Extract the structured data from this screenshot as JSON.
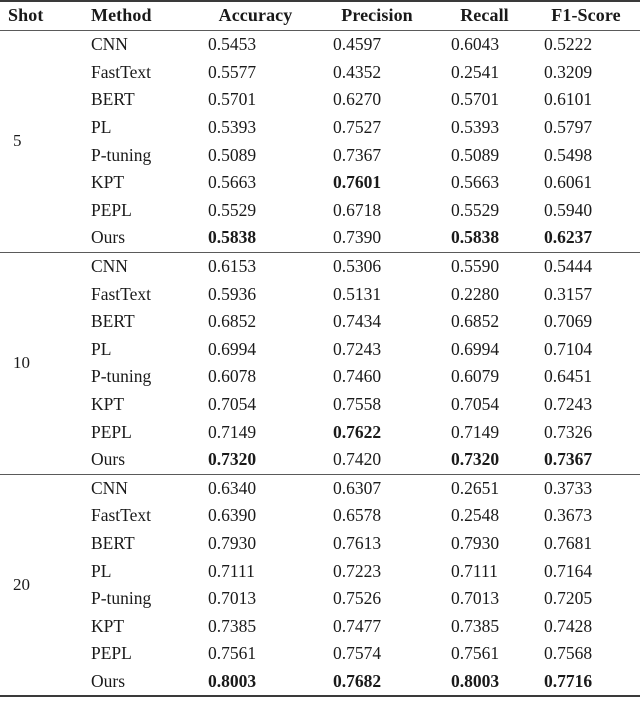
{
  "table": {
    "caption_visible": false,
    "columns": [
      "Shot",
      "Method",
      "Accuracy",
      "Precision",
      "Recall",
      "F1-Score"
    ],
    "header": {
      "shot": "Shot",
      "method": "Method",
      "accuracy": "Accuracy",
      "precision": "Precision",
      "recall": "Recall",
      "f1": "F1-Score"
    },
    "blocks": [
      {
        "shot": "5",
        "rows": [
          {
            "method": "CNN",
            "accuracy": "0.5453",
            "precision": "0.4597",
            "recall": "0.6043",
            "f1": "0.5222",
            "bold": {
              "accuracy": false,
              "precision": false,
              "recall": false,
              "f1": false
            }
          },
          {
            "method": "FastText",
            "accuracy": "0.5577",
            "precision": "0.4352",
            "recall": "0.2541",
            "f1": "0.3209",
            "bold": {
              "accuracy": false,
              "precision": false,
              "recall": false,
              "f1": false
            }
          },
          {
            "method": "BERT",
            "accuracy": "0.5701",
            "precision": "0.6270",
            "recall": "0.5701",
            "f1": "0.6101",
            "bold": {
              "accuracy": false,
              "precision": false,
              "recall": false,
              "f1": false
            }
          },
          {
            "method": "PL",
            "accuracy": "0.5393",
            "precision": "0.7527",
            "recall": "0.5393",
            "f1": "0.5797",
            "bold": {
              "accuracy": false,
              "precision": false,
              "recall": false,
              "f1": false
            }
          },
          {
            "method": "P-tuning",
            "accuracy": "0.5089",
            "precision": "0.7367",
            "recall": "0.5089",
            "f1": "0.5498",
            "bold": {
              "accuracy": false,
              "precision": false,
              "recall": false,
              "f1": false
            }
          },
          {
            "method": "KPT",
            "accuracy": "0.5663",
            "precision": "0.7601",
            "recall": "0.5663",
            "f1": "0.6061",
            "bold": {
              "accuracy": false,
              "precision": true,
              "recall": false,
              "f1": false
            }
          },
          {
            "method": "PEPL",
            "accuracy": "0.5529",
            "precision": "0.6718",
            "recall": "0.5529",
            "f1": "0.5940",
            "bold": {
              "accuracy": false,
              "precision": false,
              "recall": false,
              "f1": false
            }
          },
          {
            "method": "Ours",
            "accuracy": "0.5838",
            "precision": "0.7390",
            "recall": "0.5838",
            "f1": "0.6237",
            "bold": {
              "accuracy": true,
              "precision": false,
              "recall": true,
              "f1": true
            }
          }
        ]
      },
      {
        "shot": "10",
        "rows": [
          {
            "method": "CNN",
            "accuracy": "0.6153",
            "precision": "0.5306",
            "recall": "0.5590",
            "f1": "0.5444",
            "bold": {
              "accuracy": false,
              "precision": false,
              "recall": false,
              "f1": false
            }
          },
          {
            "method": "FastText",
            "accuracy": "0.5936",
            "precision": "0.5131",
            "recall": "0.2280",
            "f1": "0.3157",
            "bold": {
              "accuracy": false,
              "precision": false,
              "recall": false,
              "f1": false
            }
          },
          {
            "method": "BERT",
            "accuracy": "0.6852",
            "precision": "0.7434",
            "recall": "0.6852",
            "f1": "0.7069",
            "bold": {
              "accuracy": false,
              "precision": false,
              "recall": false,
              "f1": false
            }
          },
          {
            "method": "PL",
            "accuracy": "0.6994",
            "precision": "0.7243",
            "recall": "0.6994",
            "f1": "0.7104",
            "bold": {
              "accuracy": false,
              "precision": false,
              "recall": false,
              "f1": false
            }
          },
          {
            "method": "P-tuning",
            "accuracy": "0.6078",
            "precision": "0.7460",
            "recall": "0.6079",
            "f1": "0.6451",
            "bold": {
              "accuracy": false,
              "precision": false,
              "recall": false,
              "f1": false
            }
          },
          {
            "method": "KPT",
            "accuracy": "0.7054",
            "precision": "0.7558",
            "recall": "0.7054",
            "f1": "0.7243",
            "bold": {
              "accuracy": false,
              "precision": false,
              "recall": false,
              "f1": false
            }
          },
          {
            "method": "PEPL",
            "accuracy": "0.7149",
            "precision": "0.7622",
            "recall": "0.7149",
            "f1": "0.7326",
            "bold": {
              "accuracy": false,
              "precision": true,
              "recall": false,
              "f1": false
            }
          },
          {
            "method": "Ours",
            "accuracy": "0.7320",
            "precision": "0.7420",
            "recall": "0.7320",
            "f1": "0.7367",
            "bold": {
              "accuracy": true,
              "precision": false,
              "recall": true,
              "f1": true
            }
          }
        ]
      },
      {
        "shot": "20",
        "rows": [
          {
            "method": "CNN",
            "accuracy": "0.6340",
            "precision": "0.6307",
            "recall": "0.2651",
            "f1": "0.3733",
            "bold": {
              "accuracy": false,
              "precision": false,
              "recall": false,
              "f1": false
            }
          },
          {
            "method": "FastText",
            "accuracy": "0.6390",
            "precision": "0.6578",
            "recall": "0.2548",
            "f1": "0.3673",
            "bold": {
              "accuracy": false,
              "precision": false,
              "recall": false,
              "f1": false
            }
          },
          {
            "method": "BERT",
            "accuracy": "0.7930",
            "precision": "0.7613",
            "recall": "0.7930",
            "f1": "0.7681",
            "bold": {
              "accuracy": false,
              "precision": false,
              "recall": false,
              "f1": false
            }
          },
          {
            "method": "PL",
            "accuracy": "0.7111",
            "precision": "0.7223",
            "recall": "0.7111",
            "f1": "0.7164",
            "bold": {
              "accuracy": false,
              "precision": false,
              "recall": false,
              "f1": false
            }
          },
          {
            "method": "P-tuning",
            "accuracy": "0.7013",
            "precision": "0.7526",
            "recall": "0.7013",
            "f1": "0.7205",
            "bold": {
              "accuracy": false,
              "precision": false,
              "recall": false,
              "f1": false
            }
          },
          {
            "method": "KPT",
            "accuracy": "0.7385",
            "precision": "0.7477",
            "recall": "0.7385",
            "f1": "0.7428",
            "bold": {
              "accuracy": false,
              "precision": false,
              "recall": false,
              "f1": false
            }
          },
          {
            "method": "PEPL",
            "accuracy": "0.7561",
            "precision": "0.7574",
            "recall": "0.7561",
            "f1": "0.7568",
            "bold": {
              "accuracy": false,
              "precision": false,
              "recall": false,
              "f1": false
            }
          },
          {
            "method": "Ours",
            "accuracy": "0.8003",
            "precision": "0.7682",
            "recall": "0.8003",
            "f1": "0.7716",
            "bold": {
              "accuracy": true,
              "precision": true,
              "recall": true,
              "f1": true
            }
          }
        ]
      }
    ]
  },
  "style": {
    "rule_color": "#3a3a3a",
    "midrule_color": "#5a5a5a",
    "text_color": "#1a1a1a",
    "background": "#ffffff"
  }
}
